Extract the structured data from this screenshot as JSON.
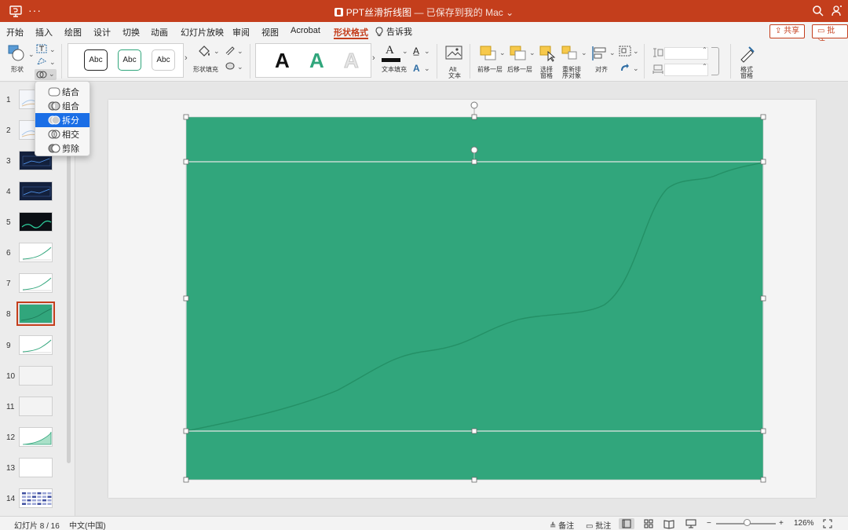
{
  "titlebar": {
    "title": "PPT丝滑折线图",
    "status": "— 已保存到我的 Mac",
    "more": "···"
  },
  "tabs": [
    {
      "label": "开始",
      "active": false
    },
    {
      "label": "插入",
      "active": false
    },
    {
      "label": "绘图",
      "active": false
    },
    {
      "label": "设计",
      "active": false
    },
    {
      "label": "切换",
      "active": false
    },
    {
      "label": "动画",
      "active": false
    },
    {
      "label": "幻灯片放映",
      "active": false
    },
    {
      "label": "审阅",
      "active": false
    },
    {
      "label": "视图",
      "active": false
    },
    {
      "label": "Acrobat",
      "active": false
    },
    {
      "label": "形状格式",
      "active": true
    }
  ],
  "tell_me": "告诉我",
  "share": "共享",
  "comments": "批注",
  "ribbon": {
    "shapes_label": "形状",
    "style_sample": "Abc",
    "shape_fill_label": "形状填充",
    "wordart_letter": "A",
    "text_fill_label": "文本填充",
    "alt_text_label_1": "Alt",
    "alt_text_label_2": "文本",
    "bring_forward": "前移一层",
    "send_backward": "后移一层",
    "selection_pane_1": "选择",
    "selection_pane_2": "窗格",
    "reorder_1": "重新排",
    "reorder_2": "序对象",
    "align": "对齐",
    "format_pane_1": "格式",
    "format_pane_2": "窗格"
  },
  "merge_menu": {
    "items": [
      {
        "label": "结合",
        "selected": false
      },
      {
        "label": "组合",
        "selected": false
      },
      {
        "label": "拆分",
        "selected": true
      },
      {
        "label": "相交",
        "selected": false
      },
      {
        "label": "剪除",
        "selected": false
      }
    ]
  },
  "thumbnails": [
    {
      "num": "1",
      "style": "light"
    },
    {
      "num": "2",
      "style": "light"
    },
    {
      "num": "3",
      "style": "dark"
    },
    {
      "num": "4",
      "style": "dark"
    },
    {
      "num": "5",
      "style": "black"
    },
    {
      "num": "6",
      "style": "line"
    },
    {
      "num": "7",
      "style": "line"
    },
    {
      "num": "8",
      "style": "green",
      "selected": true
    },
    {
      "num": "9",
      "style": "line"
    },
    {
      "num": "10",
      "style": "blank"
    },
    {
      "num": "11",
      "style": "blank"
    },
    {
      "num": "12",
      "style": "area"
    },
    {
      "num": "13",
      "style": "white"
    },
    {
      "num": "14",
      "style": "table"
    }
  ],
  "colors": {
    "accent": "#c43e1c",
    "shape_fill": "#31a67c",
    "curve": "#249066",
    "selection_blue": "#1a6ee6"
  },
  "status": {
    "slide_info": "幻灯片 8 / 16",
    "language": "中文(中国)",
    "notes": "备注",
    "comments": "批注",
    "zoom": "126%"
  }
}
